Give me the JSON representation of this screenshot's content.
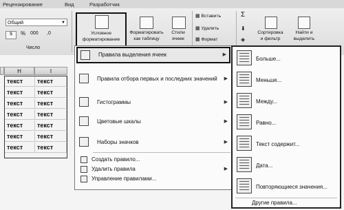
{
  "tabs": [
    "Рецензирование",
    "Вид",
    "Разработчик"
  ],
  "ribbon": {
    "number_format": "Общий",
    "percent": "%",
    "thousands": "000",
    "group_number": "Число",
    "cond_format": [
      "Условное",
      "форматирование"
    ],
    "format_table": [
      "Форматировать",
      "как таблицу"
    ],
    "cell_styles": [
      "Стили",
      "ячеек"
    ],
    "insert": "Вставить",
    "delete": "Удалить",
    "format": "Формат",
    "sort": [
      "Сортировка",
      "и фильтр"
    ],
    "find": [
      "Найти и",
      "выделить"
    ],
    "sigma": "Σ"
  },
  "sheet": {
    "col_h": "H",
    "col_i": "I",
    "cell_text": "текст",
    "rows": 7
  },
  "menu": {
    "items": [
      "Правила выделения ячеек",
      "Правила отбора первых и последних значений",
      "Гистограммы",
      "Цветовые шкалы",
      "Наборы значков",
      "Создать правило...",
      "Удалить правила",
      "Управление правилами..."
    ]
  },
  "submenu": {
    "items": [
      "Больше...",
      "Меньше...",
      "Между...",
      "Равно...",
      "Текст содержит...",
      "Дата...",
      "Повторяющиеся значения..."
    ],
    "other": "Другие правила..."
  }
}
